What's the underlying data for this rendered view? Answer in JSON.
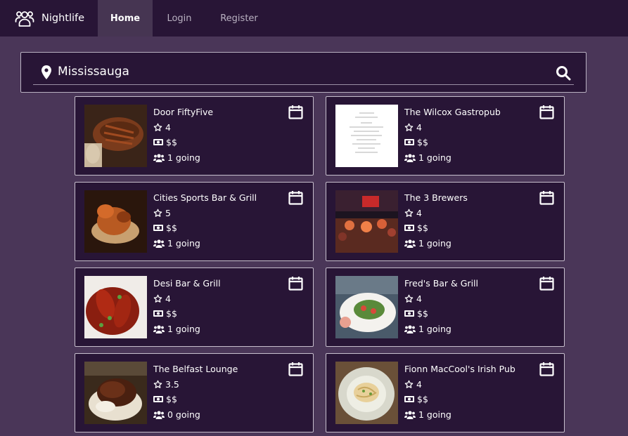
{
  "nav": {
    "brand": "Nightlife",
    "home": "Home",
    "login": "Login",
    "register": "Register"
  },
  "search": {
    "value": "Mississauga",
    "placeholder": ""
  },
  "bars": [
    {
      "name": "Door FiftyFive",
      "rating": "4",
      "price": "$$",
      "going": "1 going",
      "image": "ribs-photo"
    },
    {
      "name": "The Wilcox Gastropub",
      "rating": "4",
      "price": "$$",
      "going": "1 going",
      "image": "menu-page-photo"
    },
    {
      "name": "Cities Sports Bar & Grill",
      "rating": "5",
      "price": "$$",
      "going": "1 going",
      "image": "fried-food-photo"
    },
    {
      "name": "The 3 Brewers",
      "rating": "4",
      "price": "$$",
      "going": "1 going",
      "image": "crowd-night-photo"
    },
    {
      "name": "Desi Bar & Grill",
      "rating": "4",
      "price": "$$",
      "going": "1 going",
      "image": "chicken-wings-photo"
    },
    {
      "name": "Fred's Bar & Grill",
      "rating": "4",
      "price": "$$",
      "going": "1 going",
      "image": "salad-plate-photo"
    },
    {
      "name": "The Belfast Lounge",
      "rating": "3.5",
      "price": "$$",
      "going": "0 going",
      "image": "burger-photo"
    },
    {
      "name": "Fionn MacCool's Irish Pub",
      "rating": "4",
      "price": "$$",
      "going": "1 going",
      "image": "pasta-bowl-photo"
    }
  ],
  "icons": {
    "brand": "people-group-icon",
    "search_pin": "map-pin-icon",
    "search": "search-icon",
    "calendar": "calendar-icon",
    "rating": "star-icon",
    "price": "money-bill-icon",
    "going": "users-icon"
  },
  "colors": {
    "page_bg": "#4a3658",
    "panel_bg": "#281536",
    "border": "#c7bfcd",
    "nav_active_bg": "#463552",
    "text": "#ffffff",
    "nav_text": "#b9b1c1"
  }
}
